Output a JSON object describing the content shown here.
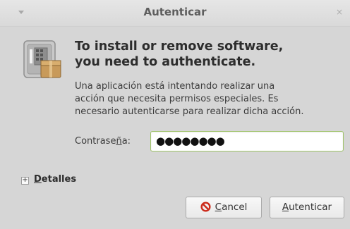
{
  "window": {
    "title": "Autenticar",
    "close_glyph": "×"
  },
  "dialog": {
    "app_icon": "package-lock-icon",
    "heading_line1": "To install or remove software,",
    "heading_line2": "you need to authenticate.",
    "description_line1": "Una aplicación está intentando realizar una",
    "description_line2": "acción que necesita permisos especiales. Es",
    "description_line3": "necesario autenticarse para realizar dicha acción.",
    "password": {
      "label_pre": "Contrase",
      "label_mnemonic": "ñ",
      "label_post": "a:",
      "masked_value": "●●●●●●●●"
    },
    "details": {
      "expander_glyph": "+",
      "label_mnemonic": "D",
      "label_rest": "etalles"
    },
    "buttons": {
      "cancel_mnemonic": "C",
      "cancel_rest": "ancel",
      "authenticate_mnemonic": "A",
      "authenticate_rest": "utenticar"
    }
  },
  "colors": {
    "window_bg": "#d6d6d6",
    "field_focus_border": "#9fc36a",
    "cancel_icon_red": "#cc2a1a"
  }
}
